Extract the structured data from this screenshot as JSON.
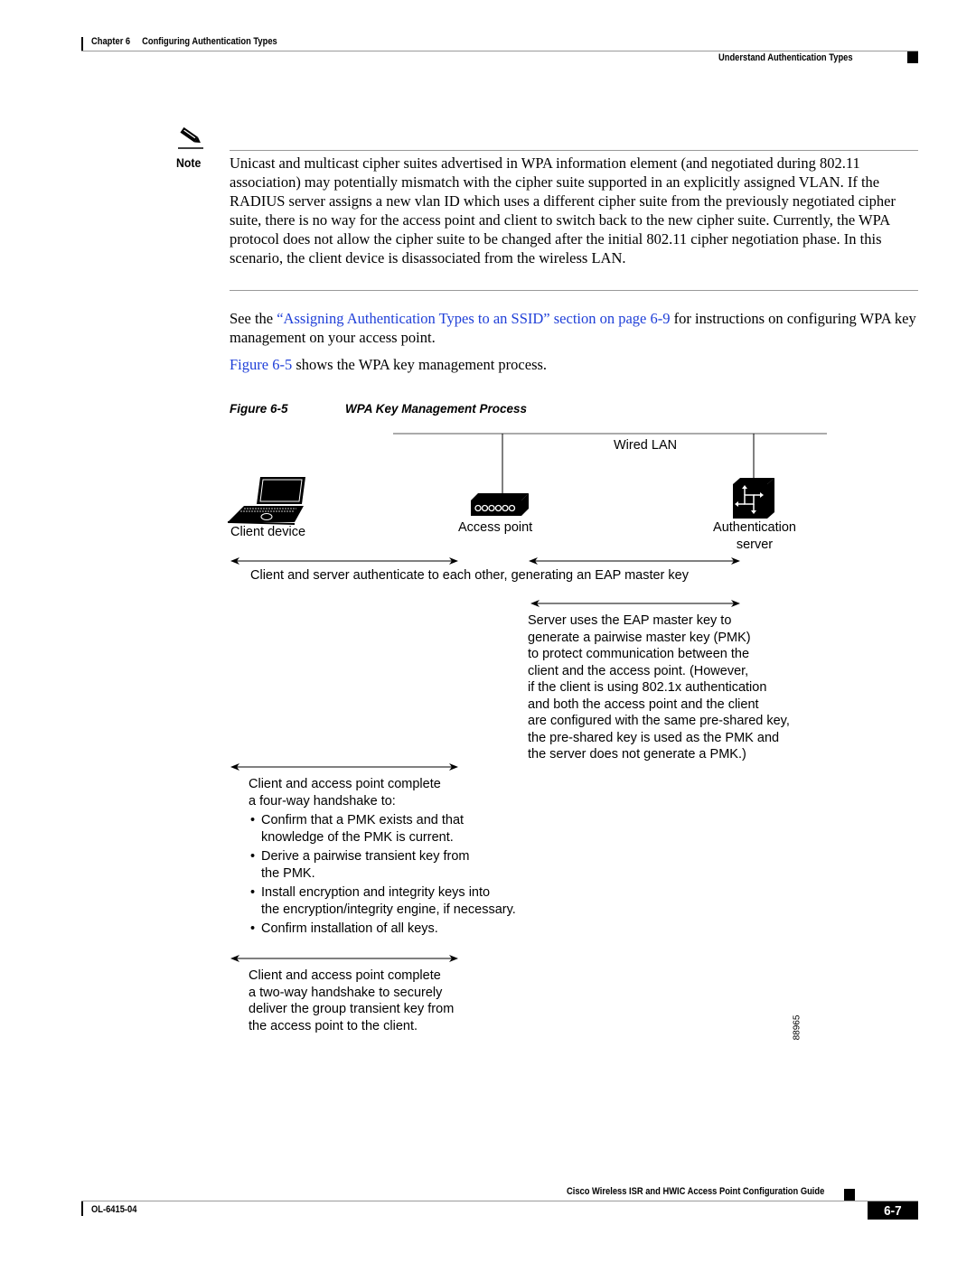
{
  "header": {
    "chapter": "Chapter 6",
    "chapter_title": "Configuring Authentication Types",
    "section": "Understand Authentication Types"
  },
  "note": {
    "label": "Note",
    "icon": "pencil-icon",
    "text": "Unicast and multicast cipher suites advertised in WPA information element (and negotiated during 802.11 association) may potentially mismatch with the cipher suite supported in an explicitly assigned VLAN. If the RADIUS server assigns a new vlan ID which uses a different cipher suite from the previously negotiated cipher suite, there is no way for the access point and client to switch back to the new cipher suite. Currently, the WPA protocol does not allow the cipher suite to be changed after the initial 802.11 cipher negotiation phase. In this scenario, the client device is disassociated from the wireless LAN."
  },
  "body": {
    "para1_prefix": "See the ",
    "para1_link": "“Assigning Authentication Types to an SSID” section on page 6-9",
    "para1_suffix": " for instructions on configuring WPA key management on your access point.",
    "para2_link": "Figure 6-5",
    "para2_suffix": " shows the WPA key management process."
  },
  "figure": {
    "number": "Figure 6-5",
    "title": "WPA Key Management Process",
    "wired_lan": "Wired LAN",
    "client_device": "Client device",
    "access_point": "Access point",
    "auth_server_line1": "Authentication",
    "auth_server_line2": "server",
    "step1": "Client and server authenticate to each other, generating an EAP master key",
    "step2_lines": [
      "Server uses the EAP master key to",
      "generate a pairwise master key (PMK)",
      "to protect communication between the",
      "client and the access point. (However,",
      "if the client is using 802.1x authentication",
      "and both the access point and the client",
      "are configured with the same pre-shared key,",
      "the pre-shared key is used as the PMK and",
      "the server does not generate a PMK.)"
    ],
    "step3_intro_lines": [
      "Client and access point complete",
      "a four-way handshake to:"
    ],
    "step3_bullets": [
      "Confirm that a PMK exists and that knowledge of the PMK is current.",
      "Derive a pairwise transient key from the PMK.",
      "Install encryption and integrity keys into the encryption/integrity engine, if necessary.",
      "Confirm installation of all keys."
    ],
    "step3_bullets_lines": [
      [
        "Confirm that a PMK exists and that",
        "knowledge of the PMK is current."
      ],
      [
        "Derive a pairwise transient key from",
        "the PMK."
      ],
      [
        "Install encryption and integrity keys into",
        "the encryption/integrity engine, if necessary."
      ],
      [
        "Confirm installation of all keys."
      ]
    ],
    "step4_lines": [
      "Client and access point complete",
      "a two-way handshake to securely",
      "deliver the group transient key from",
      "the access point to the client."
    ],
    "figure_id": "88965"
  },
  "footer": {
    "guide_title": "Cisco Wireless ISR and HWIC Access Point Configuration Guide",
    "doc_number": "OL-6415-04",
    "page_number": "6-7"
  }
}
